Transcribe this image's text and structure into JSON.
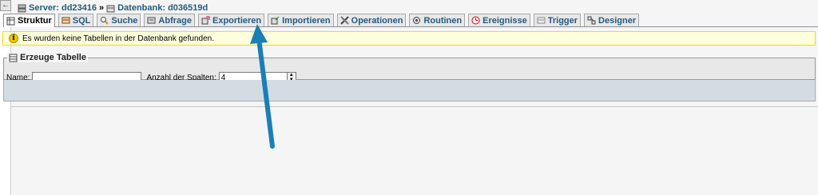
{
  "breadcrumb": {
    "server_label": "Server: dd23416",
    "separator": "»",
    "database_label": "Datenbank: d036519d"
  },
  "tabs": [
    {
      "label": "Struktur",
      "icon": "structure-icon",
      "active": true
    },
    {
      "label": "SQL",
      "icon": "sql-icon"
    },
    {
      "label": "Suche",
      "icon": "search-icon"
    },
    {
      "label": "Abfrage",
      "icon": "query-icon"
    },
    {
      "label": "Exportieren",
      "icon": "export-icon"
    },
    {
      "label": "Importieren",
      "icon": "import-icon"
    },
    {
      "label": "Operationen",
      "icon": "operations-icon"
    },
    {
      "label": "Routinen",
      "icon": "routines-icon"
    },
    {
      "label": "Ereignisse",
      "icon": "events-icon"
    },
    {
      "label": "Trigger",
      "icon": "trigger-icon"
    },
    {
      "label": "Designer",
      "icon": "designer-icon"
    }
  ],
  "notice": {
    "icon": "info-icon",
    "text": "Es wurden keine Tabellen in der Datenbank gefunden."
  },
  "create_table": {
    "legend": "Erzeuge Tabelle",
    "name_label": "Name:",
    "name_value": "",
    "columns_label": "Anzahl der Spalten:",
    "columns_value": "4"
  },
  "colors": {
    "link": "#235a81",
    "notice_bg": "#ffffdd",
    "notice_border": "#ffd700",
    "arrow": "#1a7fb5",
    "footer_bar": "#d3dce3"
  }
}
